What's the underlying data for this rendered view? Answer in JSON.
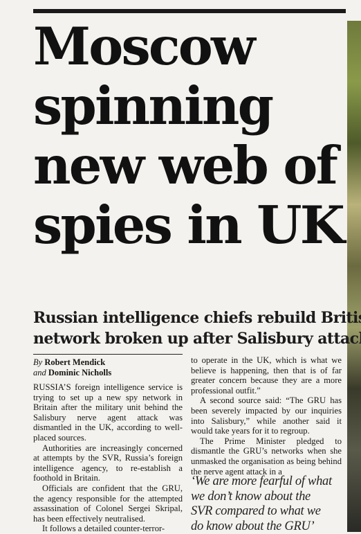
{
  "headline": {
    "lines": [
      "Moscow",
      "spinning",
      "new web of",
      "spies in UK"
    ]
  },
  "standfirst": {
    "lines": [
      "Russian intelligence chiefs rebuild British",
      "network broken up after Salisbury attack"
    ]
  },
  "byline": {
    "by": "By",
    "author1": "Robert Mendick",
    "and": "and",
    "author2": "Dominic Nicholls"
  },
  "article": {
    "left_column": [
      "RUSSIA’S foreign intelligence service is trying to set up a new spy network in Britain after the military unit behind the Salisbury nerve agent attack was dismantled in the UK, according to well-placed sources.",
      "Authorities are increasingly concerned at attempts by the SVR, Russia’s foreign intelligence agency, to re-establish a foothold in Britain.",
      "Officials are confident that the GRU, the agency responsible for the attempted assassination of Colonel Sergei Skripal, has been effectively neutralised.",
      "It follows a detailed counter-terror-"
    ],
    "right_column": [
      "to operate in the UK, which is what we believe is happening, then that is of far greater concern because they are a more professional outfit.”",
      "A second source said: “The GRU has been severely impacted by our inquiries into Salisbury,” while another said it would take years for it to regroup.",
      "The Prime Minister pledged to dismantle the GRU’s networks when she unmasked the organisation as being behind the nerve agent attack in a"
    ]
  },
  "pull_quote": {
    "lines": [
      "‘We are more fearful of what",
      "we don’t know about the",
      "SVR compared to what we",
      "do know about the GRU’"
    ]
  }
}
